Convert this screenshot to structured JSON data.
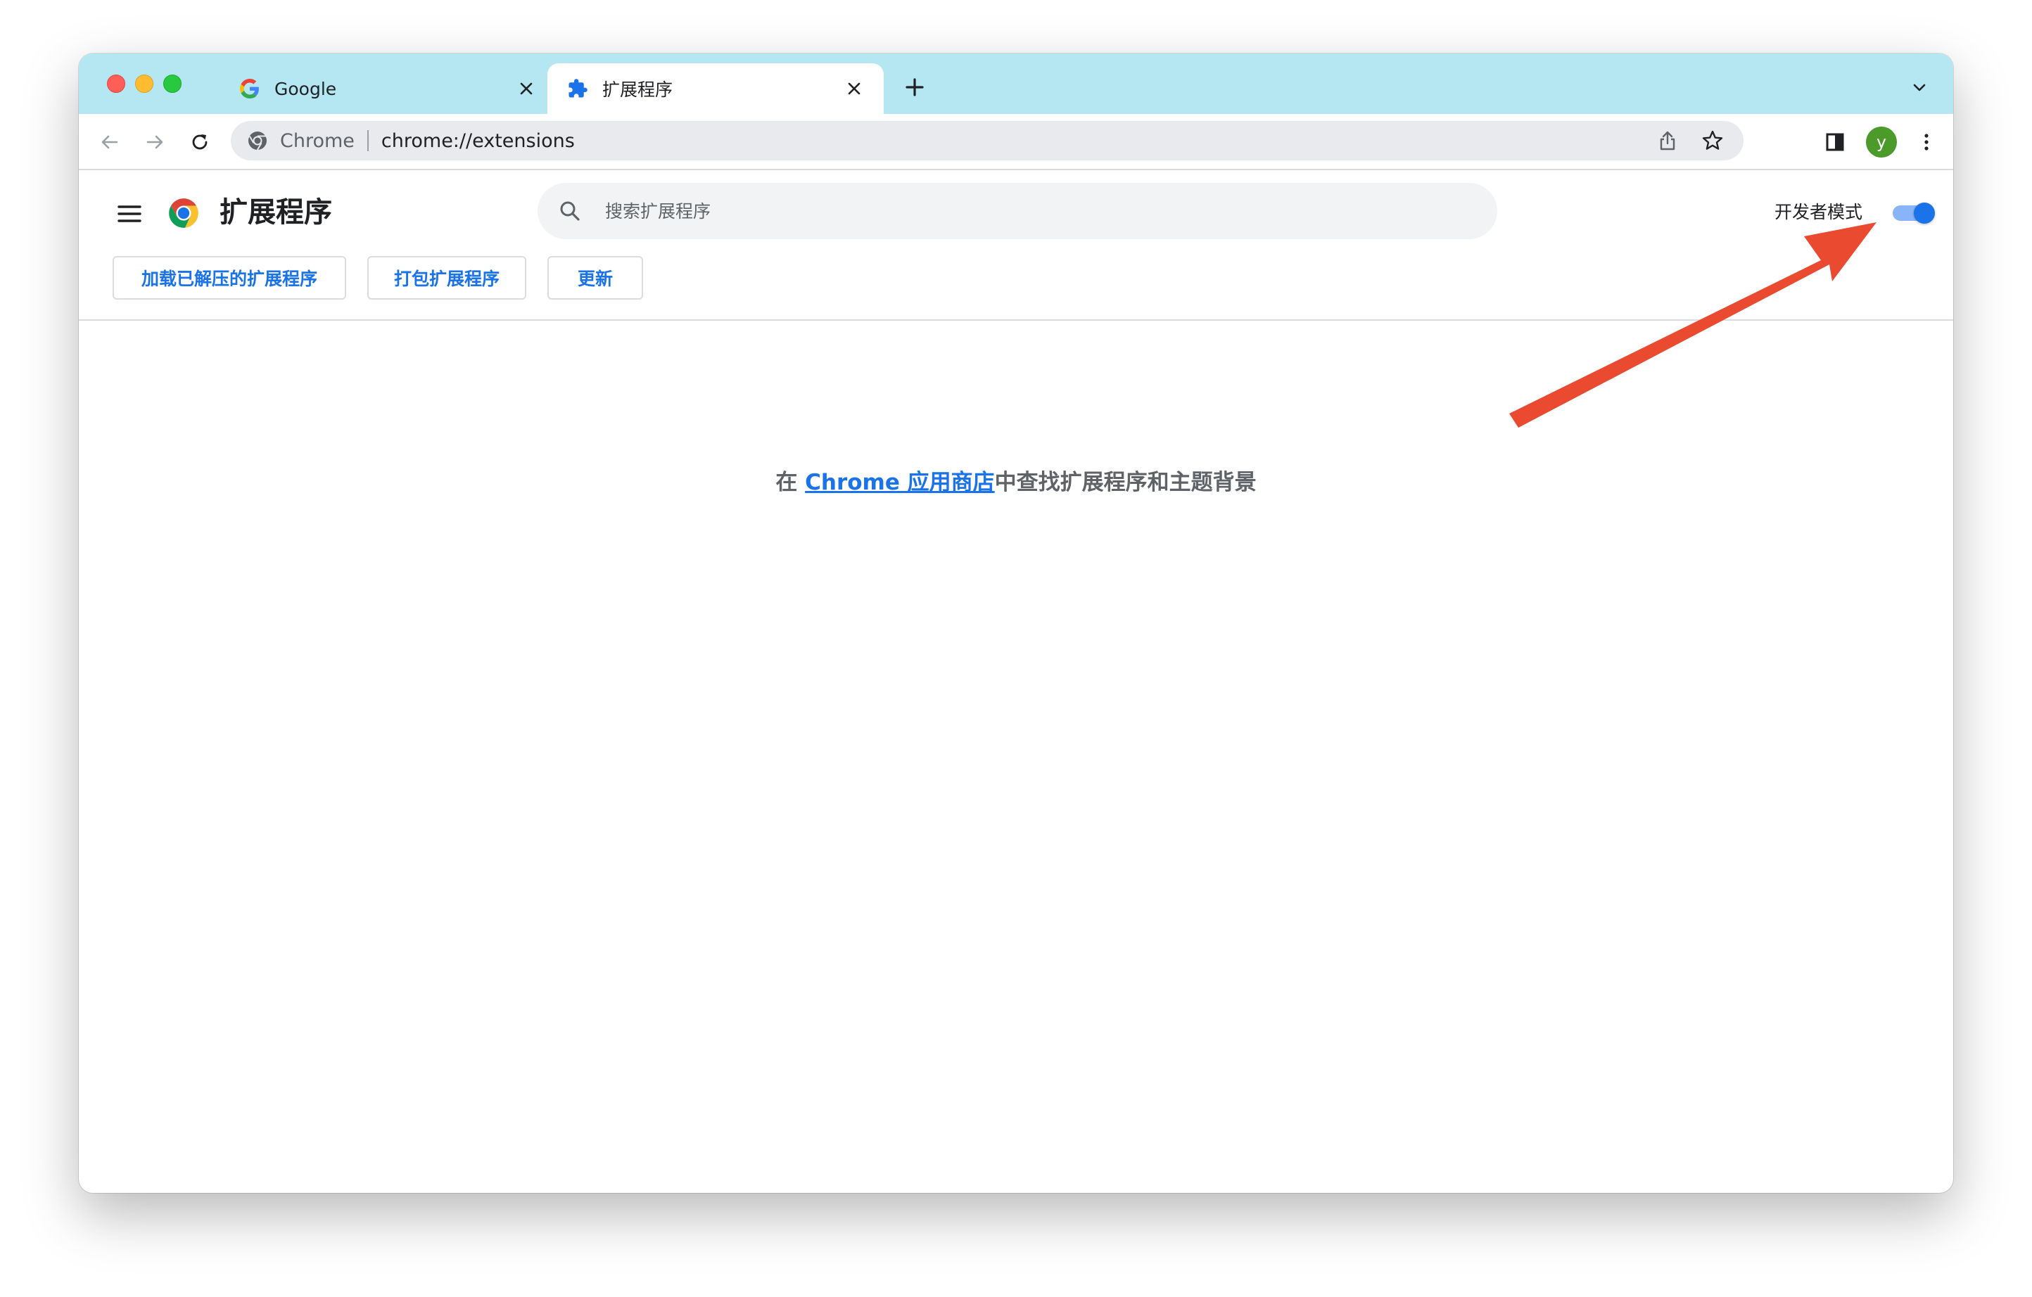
{
  "tabs": [
    {
      "title": "Google",
      "favicon": "google-g-icon",
      "active": false
    },
    {
      "title": "扩展程序",
      "favicon": "puzzle-piece-icon",
      "active": true
    }
  ],
  "omnibox": {
    "chip": "Chrome",
    "url": "chrome://extensions"
  },
  "profile": {
    "initial": "y"
  },
  "extensions_page": {
    "title": "扩展程序",
    "search_placeholder": "搜索扩展程序",
    "dev_mode_label": "开发者模式",
    "dev_mode_enabled": true,
    "buttons": {
      "load_unpacked": "加载已解压的扩展程序",
      "pack": "打包扩展程序",
      "update": "更新"
    },
    "empty_message": {
      "prefix": "在 ",
      "link": "Chrome 应用商店",
      "suffix": "中查找扩展程序和主题背景"
    }
  },
  "colors": {
    "tabstrip": "#b4e7f2",
    "accent": "#1a73e8",
    "annotation_arrow": "#ea4a2f",
    "avatar": "#4c9a2a"
  }
}
